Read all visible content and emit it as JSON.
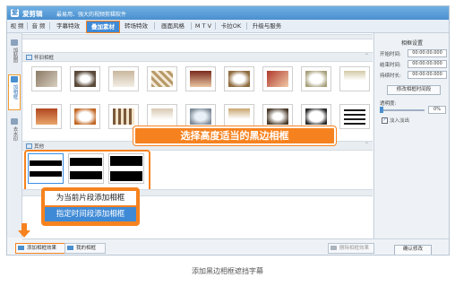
{
  "app": {
    "name": "爱剪辑",
    "slogan": "最易用、强大的视频剪辑软件",
    "logo_glyph": "爱"
  },
  "menu": {
    "tabs": [
      {
        "label": "视 频"
      },
      {
        "label": "音 频"
      },
      {
        "label": "字幕特效"
      },
      {
        "label": "叠加素材",
        "active": true
      },
      {
        "label": "转场特效"
      },
      {
        "label": "画面风格"
      },
      {
        "label": "M T V"
      },
      {
        "label": "卡拉OK"
      },
      {
        "label": "升级与服务"
      }
    ]
  },
  "leftnav": {
    "items": [
      {
        "label": "加贴图"
      },
      {
        "label": "加相框",
        "active": true
      },
      {
        "label": "去水印"
      }
    ]
  },
  "sections": {
    "vintage": "怀旧相框",
    "other": "其他"
  },
  "callouts": {
    "select_frame": "选择高度适当的黑边相框"
  },
  "context_menu": {
    "item1": "为当前片段添加相框",
    "item2": "指定时间段添加相框"
  },
  "bottom": {
    "add_frame": "添加相框效果",
    "my_frames": "我的相框",
    "delete_frame": "删除相框效果"
  },
  "right_panel": {
    "title": "相框设置",
    "start_label": "开始时间:",
    "start_value": "00:00:00.000",
    "end_label": "结束时间:",
    "end_value": "00:00:00.000",
    "duration_label": "持续时长:",
    "duration_value": "00:00:00.000",
    "modify_time_btn": "修改相框时间段",
    "opacity_label": "透明度:",
    "opacity_value": "0%",
    "fade_label": "淡入淡出",
    "confirm_btn": "确认修改"
  },
  "caption": "添加黑边相框遮挡字幕",
  "colors": {
    "accent_orange": "#f6821f",
    "accent_blue": "#3f8ad6"
  }
}
